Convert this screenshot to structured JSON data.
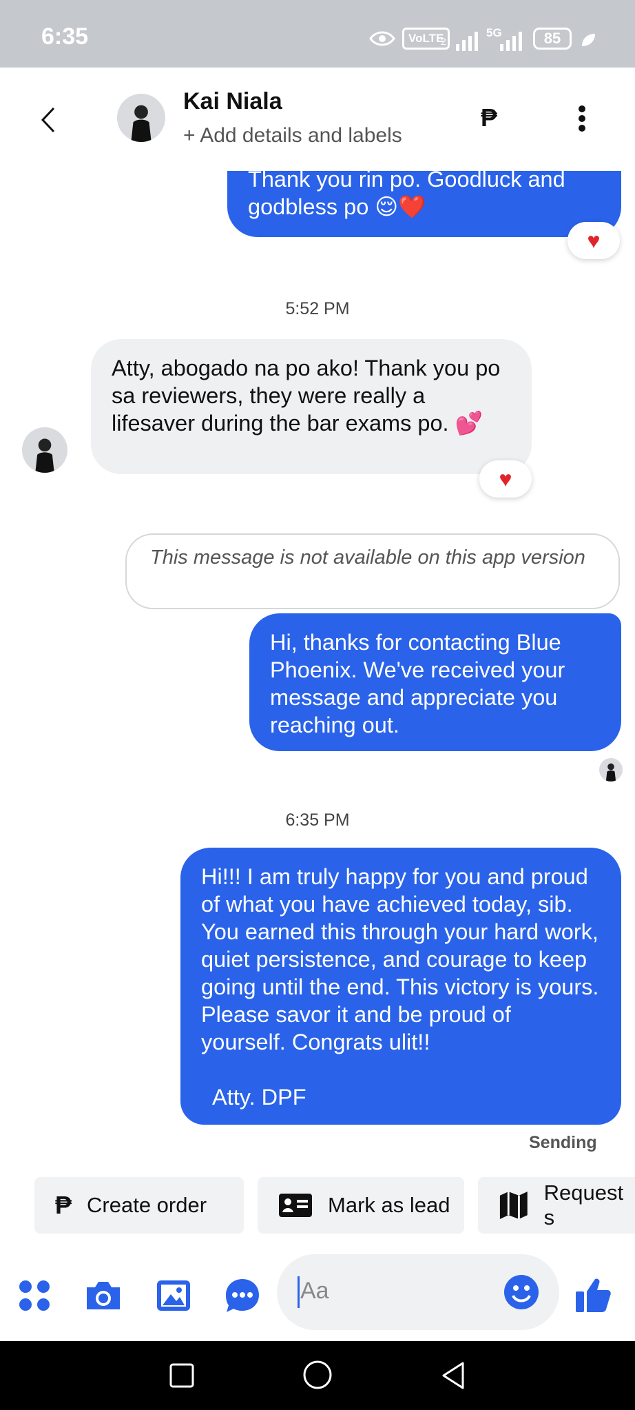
{
  "status_bar": {
    "time": "6:35",
    "network_1": "VoLTE",
    "network_2": "5G",
    "battery": "85"
  },
  "header": {
    "contact_name": "Kai Niala",
    "subtitle": "+ Add details and labels",
    "peso_icon": "₱"
  },
  "messages": {
    "out_1": "Thank you rin po. Goodluck and godbless po 😌❤️",
    "time_1": "5:52 PM",
    "in_1": "Atty, abogado na po ako! Thank you po sa reviewers, they were really a lifesaver during the bar exams po. 💕",
    "unavailable": "This message is not available on this app version",
    "out_2": "Hi, thanks for contacting Blue Phoenix. We've received your message and appreciate you reaching out.",
    "time_2": "6:35 PM",
    "out_3": "Hi!!! I am truly happy for you and proud of what you have achieved today, sib. You earned this through your hard work, quiet persistence, and courage to keep going until the end. This victory is yours. Please savor it and be proud of yourself. Congrats ulit!!",
    "out_3_sign": "Atty. DPF",
    "status": "Sending"
  },
  "quick_actions": {
    "create_order": "Create order",
    "mark_as_lead": "Mark as lead",
    "request": "Request s"
  },
  "composer": {
    "placeholder": "Aa"
  },
  "colors": {
    "accent": "#2a63ea",
    "incoming_bubble": "#eef0f2",
    "status_bar": "#c5c8cd"
  }
}
